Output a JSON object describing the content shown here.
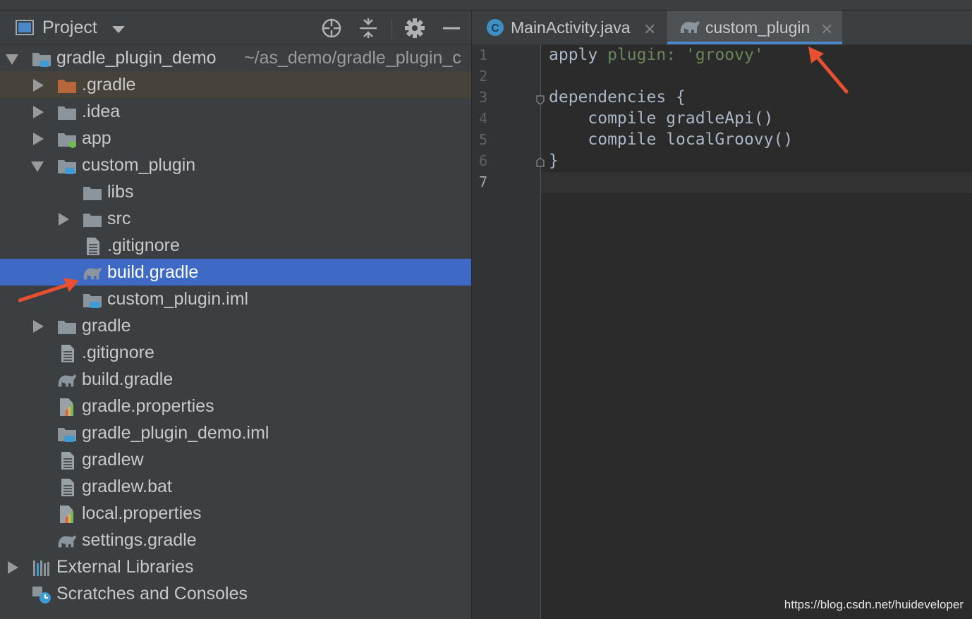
{
  "project_panel": {
    "title": "Project",
    "tree": [
      {
        "label": "gradle_plugin_demo",
        "path": "~/as_demo/gradle_plugin_c",
        "icon": "module-folder-icon",
        "expand": "down",
        "depth": 0
      },
      {
        "label": ".gradle",
        "icon": "folder-orange-icon",
        "expand": "right",
        "depth": 1
      },
      {
        "label": ".idea",
        "icon": "folder-icon",
        "expand": "right",
        "depth": 1
      },
      {
        "label": "app",
        "icon": "android-module-folder-icon",
        "expand": "right",
        "depth": 1
      },
      {
        "label": "custom_plugin",
        "icon": "module-folder-icon",
        "expand": "down",
        "depth": 1
      },
      {
        "label": "libs",
        "icon": "folder-icon",
        "expand": "none",
        "depth": 2
      },
      {
        "label": "src",
        "icon": "folder-icon",
        "expand": "right",
        "depth": 2
      },
      {
        "label": ".gitignore",
        "icon": "text-file-icon",
        "expand": "none",
        "depth": 2
      },
      {
        "label": "build.gradle",
        "icon": "gradle-elephant-icon",
        "expand": "none",
        "depth": 2,
        "selected": true
      },
      {
        "label": "custom_plugin.iml",
        "icon": "iml-file-icon",
        "expand": "none",
        "depth": 2
      },
      {
        "label": "gradle",
        "icon": "folder-icon",
        "expand": "right",
        "depth": 1
      },
      {
        "label": ".gitignore",
        "icon": "text-file-icon",
        "expand": "none",
        "depth": 1
      },
      {
        "label": "build.gradle",
        "icon": "gradle-elephant-icon",
        "expand": "none",
        "depth": 1
      },
      {
        "label": "gradle.properties",
        "icon": "properties-file-icon",
        "expand": "none",
        "depth": 1
      },
      {
        "label": "gradle_plugin_demo.iml",
        "icon": "iml-file-icon",
        "expand": "none",
        "depth": 1
      },
      {
        "label": "gradlew",
        "icon": "text-file-icon",
        "expand": "none",
        "depth": 1
      },
      {
        "label": "gradlew.bat",
        "icon": "text-file-icon",
        "expand": "none",
        "depth": 1
      },
      {
        "label": "local.properties",
        "icon": "properties-file-icon",
        "expand": "none",
        "depth": 1
      },
      {
        "label": "settings.gradle",
        "icon": "gradle-elephant-icon",
        "expand": "none",
        "depth": 1
      },
      {
        "label": "External Libraries",
        "icon": "libraries-icon",
        "expand": "right",
        "depth": 0
      },
      {
        "label": "Scratches and Consoles",
        "icon": "scratches-icon",
        "expand": "none",
        "depth": 0
      }
    ]
  },
  "editor": {
    "tabs": [
      {
        "label": "MainActivity.java",
        "icon": "java-class-icon",
        "active": false
      },
      {
        "label": "custom_plugin",
        "icon": "gradle-elephant-icon",
        "active": true
      }
    ],
    "line_numbers": [
      "1",
      "2",
      "3",
      "4",
      "5",
      "6",
      "7"
    ],
    "current_line": "7",
    "code": {
      "l1_apply": "apply",
      "l1_plugin": "plugin:",
      "l1_value": "'groovy'",
      "l3_dependencies": "dependencies",
      "l3_brace": "{",
      "l4_compile": "compile",
      "l4_call": "gradleApi()",
      "l5_compile": "compile",
      "l5_call": "localGroovy()",
      "l6_brace": "}"
    }
  },
  "watermark": "https://blog.csdn.net/huideveloper",
  "colors": {
    "panel_bg": "#3c3f41",
    "editor_bg": "#2b2b2b",
    "selection": "#3e6ac6",
    "keyword": "#cc7832",
    "string": "#6a8759",
    "annotation_arrow": "#e8502f"
  }
}
